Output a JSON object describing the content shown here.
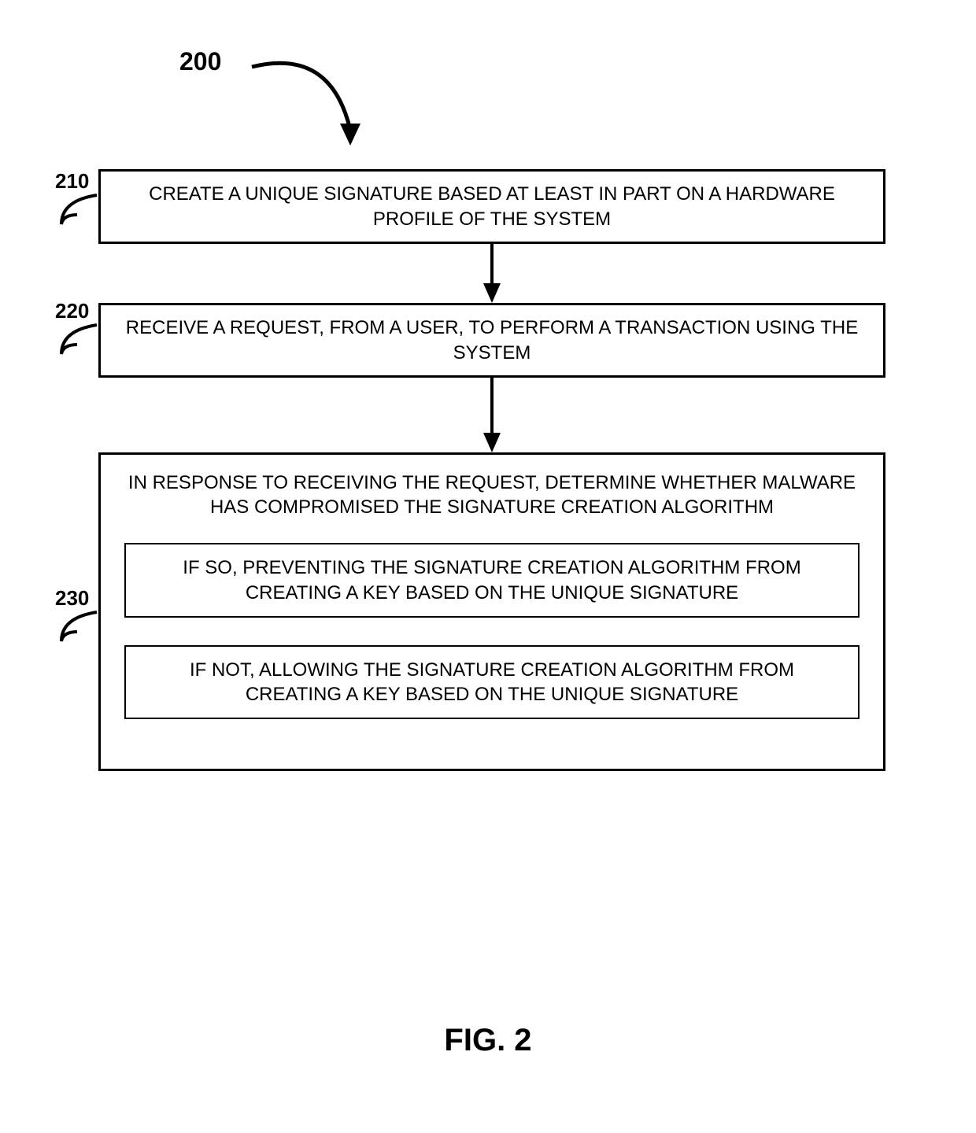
{
  "diagram": {
    "main_label": "200",
    "steps": {
      "s210": {
        "label": "210",
        "text": "CREATE A UNIQUE SIGNATURE BASED AT LEAST IN PART ON A HARDWARE PROFILE OF THE SYSTEM"
      },
      "s220": {
        "label": "220",
        "text": "RECEIVE A REQUEST, FROM A USER, TO PERFORM A TRANSACTION USING THE SYSTEM"
      },
      "s230": {
        "label": "230",
        "title": "IN RESPONSE TO RECEIVING THE REQUEST, DETERMINE WHETHER MALWARE HAS COMPROMISED THE SIGNATURE CREATION ALGORITHM",
        "sub_a": "IF SO, PREVENTING THE SIGNATURE CREATION ALGORITHM FROM CREATING A KEY BASED ON THE UNIQUE SIGNATURE",
        "sub_b": "IF NOT, ALLOWING THE SIGNATURE CREATION ALGORITHM FROM CREATING A KEY BASED ON THE UNIQUE SIGNATURE"
      }
    },
    "figure_label": "FIG. 2"
  }
}
